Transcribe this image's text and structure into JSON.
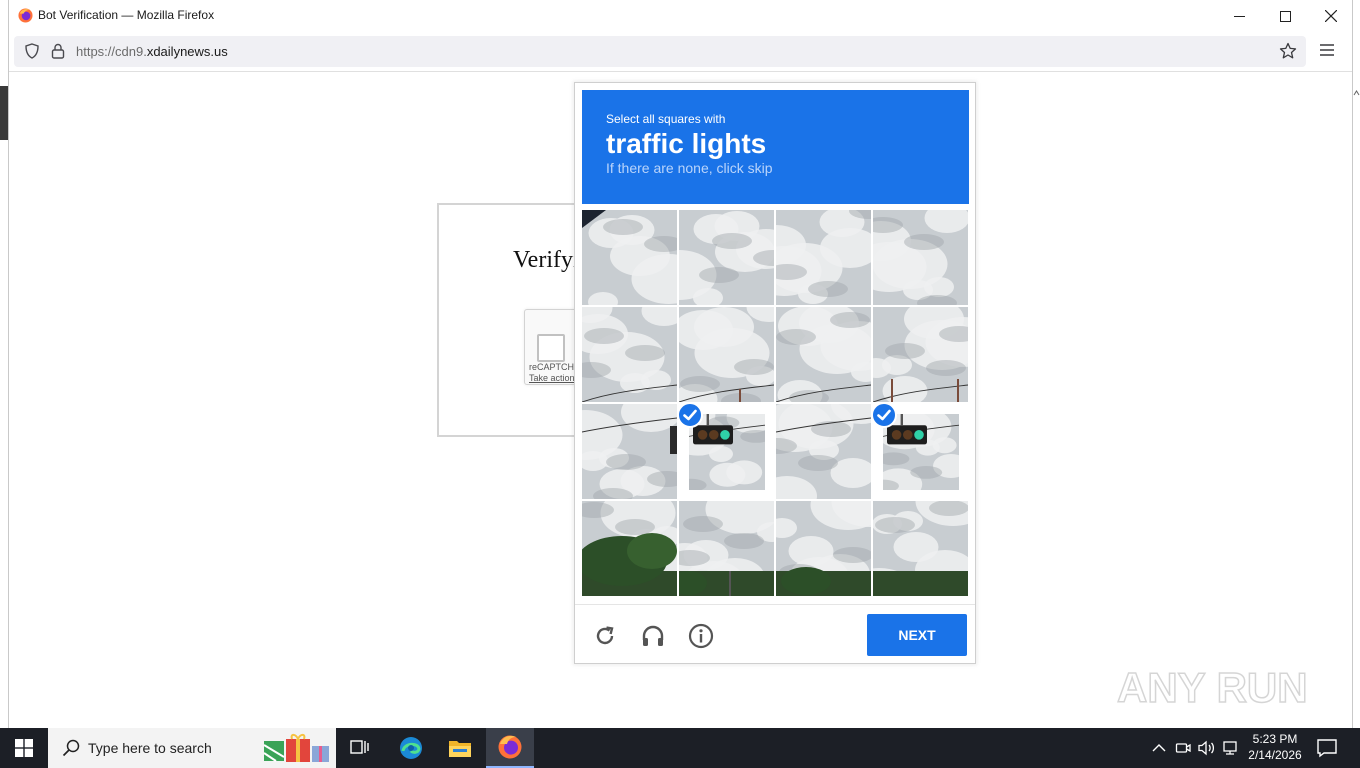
{
  "window": {
    "title": "Bot Verification — Mozilla Firefox",
    "minimize_glyph": "—",
    "maximize_glyph": "☐",
    "close_glyph": "✕"
  },
  "navbar": {
    "url_prefix": "https://cdn9.",
    "url_domain": "xdailynews.us"
  },
  "page": {
    "verify_heading": "Verifyi",
    "recaptcha_label": "reCAPTCHA",
    "recaptcha_link": "Take action"
  },
  "challenge": {
    "instruction_small": "Select all squares with",
    "target": "traffic lights",
    "hint": "If there are none, click skip",
    "next_label": "NEXT",
    "selected_tiles": [
      9,
      11
    ],
    "icons": [
      "reload-icon",
      "audio-icon",
      "info-icon"
    ]
  },
  "watermark": {
    "text": "ANY RUN"
  },
  "taskbar": {
    "search_placeholder": "Type here to search",
    "time": "5:23 PM",
    "date": "2/14/2026"
  },
  "colors": {
    "accent": "#1a73e8",
    "taskbar": "#1c1f26"
  }
}
